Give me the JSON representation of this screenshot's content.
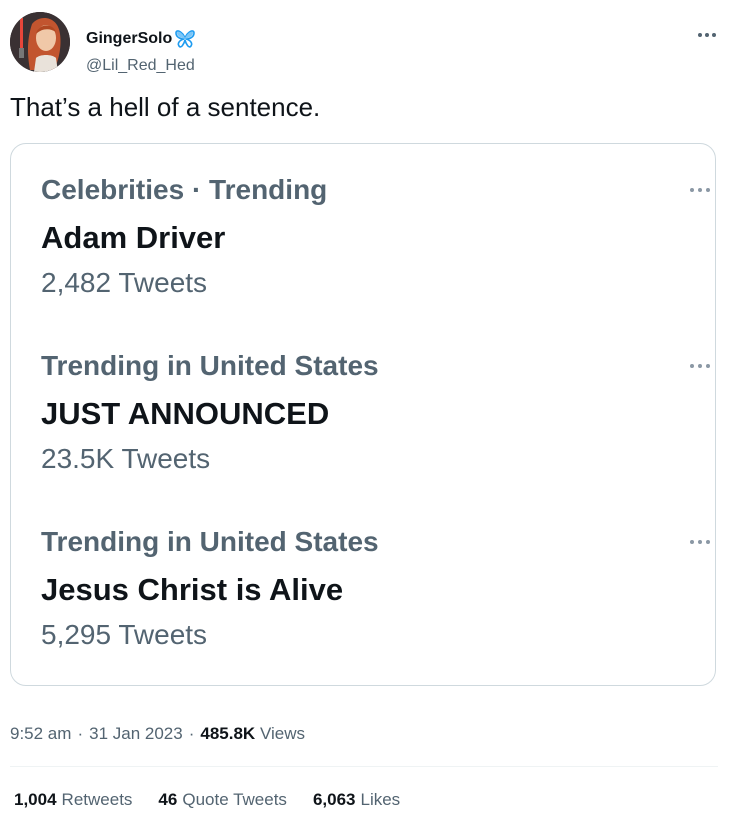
{
  "author": {
    "display_name": "GingerSolo",
    "handle": "@Lil_Red_Hed",
    "badge_icon": "butterfly-icon",
    "badge_color": "#1d9bf0"
  },
  "tweet": {
    "text": "That’s a hell of a sentence."
  },
  "trends": [
    {
      "meta": "Celebrities · Trending",
      "title": "Adam Driver",
      "count": "2,482 Tweets"
    },
    {
      "meta": "Trending in United States",
      "title": "JUST ANNOUNCED",
      "count": "23.5K Tweets"
    },
    {
      "meta": "Trending in United States",
      "title": "Jesus Christ is Alive",
      "count": "5,295 Tweets"
    }
  ],
  "meta": {
    "time": "9:52 am",
    "sep1": "·",
    "date": "31 Jan 2023",
    "sep2": "·",
    "views_count": "485.8K",
    "views_label": "Views"
  },
  "stats": {
    "retweets_count": "1,004",
    "retweets_label": "Retweets",
    "quotes_count": "46",
    "quotes_label": "Quote Tweets",
    "likes_count": "6,063",
    "likes_label": "Likes"
  },
  "colors": {
    "primary_text": "#0f1419",
    "secondary_text": "#536471",
    "border": "#cfd9de"
  }
}
